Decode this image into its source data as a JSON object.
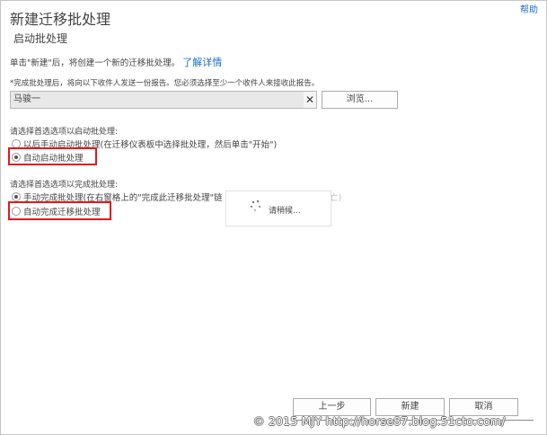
{
  "header": {
    "title": "新建迁移批处理",
    "subtitle": "启动批处理",
    "help": "帮助"
  },
  "description": {
    "text": "单击\"新建\"后，将创建一个新的迁移批处理。",
    "link": "了解详情"
  },
  "report": {
    "note": "*完成批处理后，将向以下收件人发送一份报告。您必须选择至少一个收件人来接收此报告。",
    "recipient": "马骏一",
    "clear_icon": "close-icon",
    "browse_label": "浏览..."
  },
  "start": {
    "label": "请选择首选选项以启动批处理:",
    "option_manual": "以后手动启动批处理(在迁移仪表板中选择批处理，然后单击\"开始\")",
    "option_auto": "自动启动批处理",
    "selected": "auto"
  },
  "complete": {
    "label": "请选择首选选项以完成批处理:",
    "option_manual_a": "手动完成批处理(在右窗格上的\"完成此迁移批处理\"链",
    "option_manual_b": "亡)",
    "option_auto": "自动完成迁移批处理",
    "selected": "manual"
  },
  "loading": {
    "text": "请稍候...",
    "icon": "spinner-icon"
  },
  "footer": {
    "prev": "上一步",
    "new": "新建",
    "cancel": "取消"
  },
  "watermark": "© 2015 MJY http://horse87.blog.51cto.com/",
  "colors": {
    "highlight": "#e0191e",
    "link": "#1e6fc4"
  }
}
